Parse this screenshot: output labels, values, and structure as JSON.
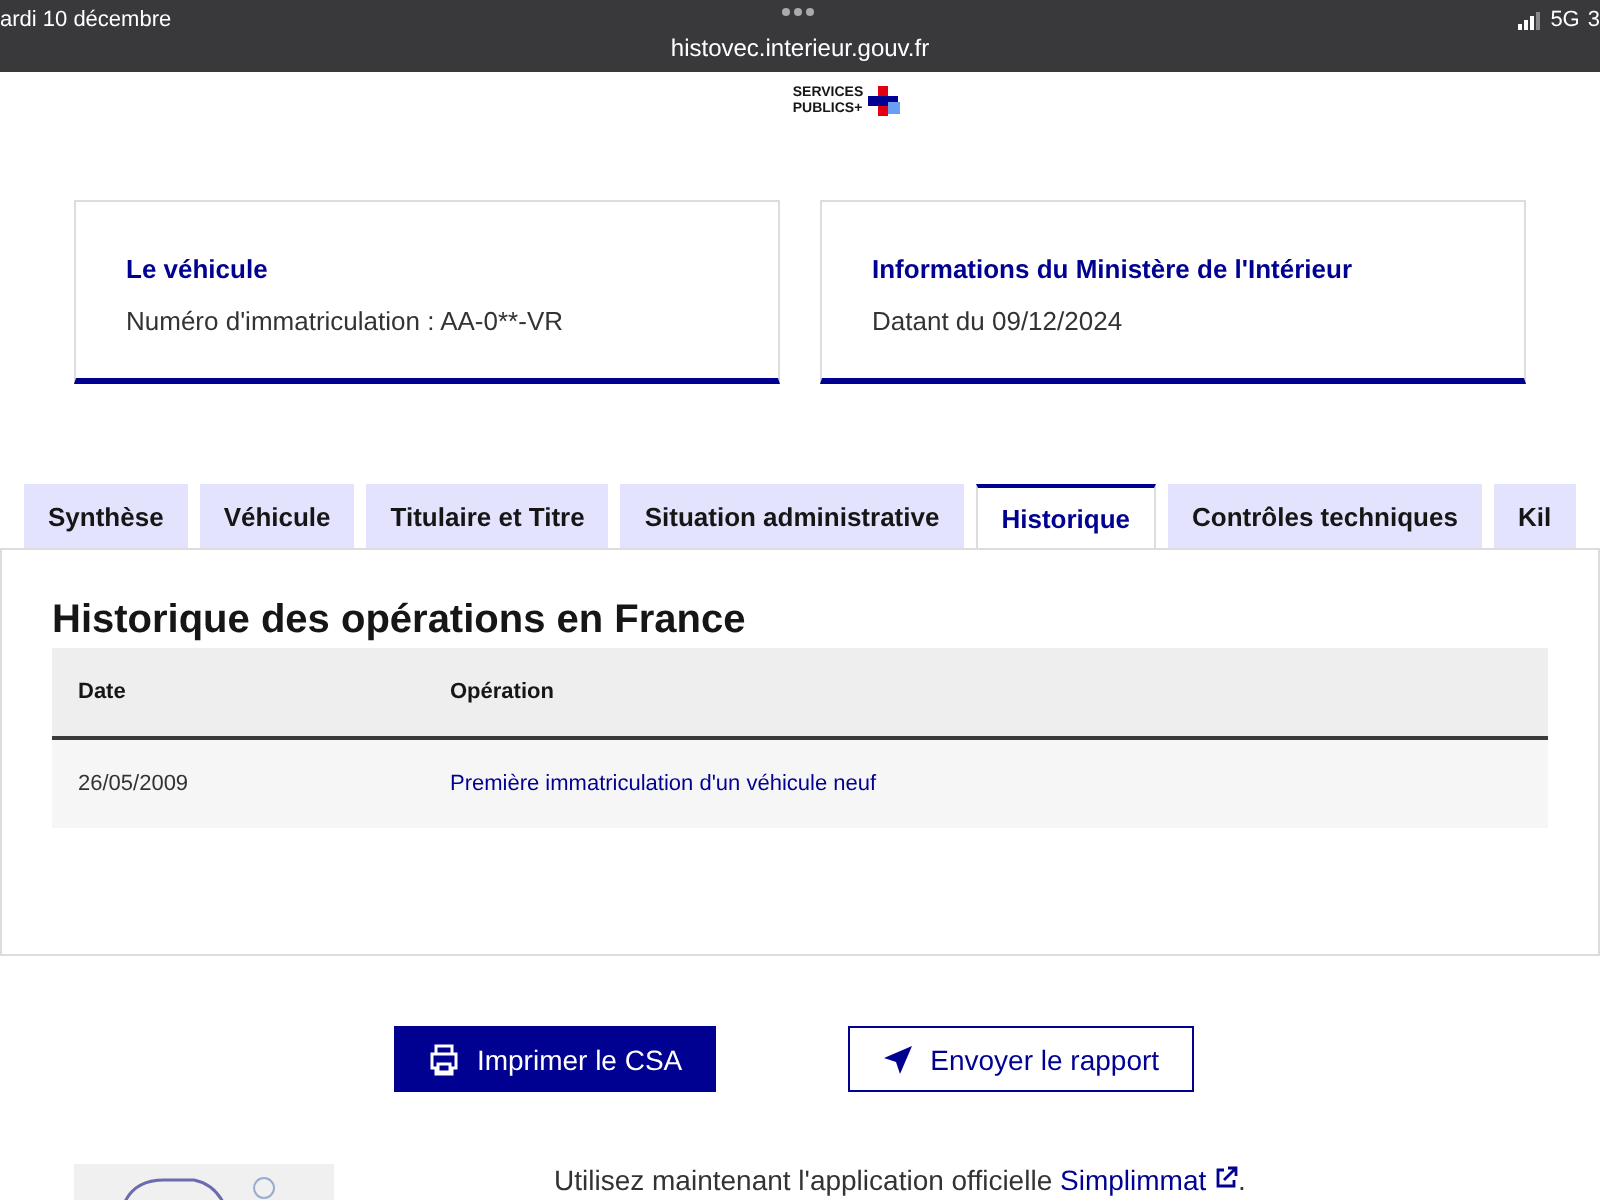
{
  "status_bar": {
    "date": "ardi 10 décembre",
    "url": "histovec.interieur.gouv.fr",
    "network": "5G",
    "battery_partial": "3"
  },
  "logo": {
    "line_1": "SERVICES",
    "line_2": "PUBLICS+"
  },
  "cards": [
    {
      "title": "Le véhicule",
      "text": "Numéro d'immatriculation : AA-0**-VR"
    },
    {
      "title": "Informations du Ministère de l'Intérieur",
      "text": "Datant du 09/12/2024"
    }
  ],
  "tabs": [
    {
      "label": "Synthèse",
      "selected": false
    },
    {
      "label": "Véhicule",
      "selected": false
    },
    {
      "label": "Titulaire et Titre",
      "selected": false
    },
    {
      "label": "Situation administrative",
      "selected": false
    },
    {
      "label": "Historique",
      "selected": true
    },
    {
      "label": "Contrôles techniques",
      "selected": false
    },
    {
      "label": "Kil",
      "selected": false
    }
  ],
  "panel": {
    "title": "Historique des opérations en France",
    "table": {
      "columns": [
        "Date",
        "Opération"
      ],
      "rows": [
        [
          "26/05/2009",
          "Première immatriculation d'un véhicule neuf"
        ]
      ]
    }
  },
  "buttons": [
    {
      "kind": "primary",
      "label": "Imprimer le CSA"
    },
    {
      "kind": "secondary",
      "label": "Envoyer le rapport"
    }
  ],
  "footer": {
    "text": "Utilisez maintenant l'application officielle",
    "link": "Simplimmat",
    "end": "."
  }
}
